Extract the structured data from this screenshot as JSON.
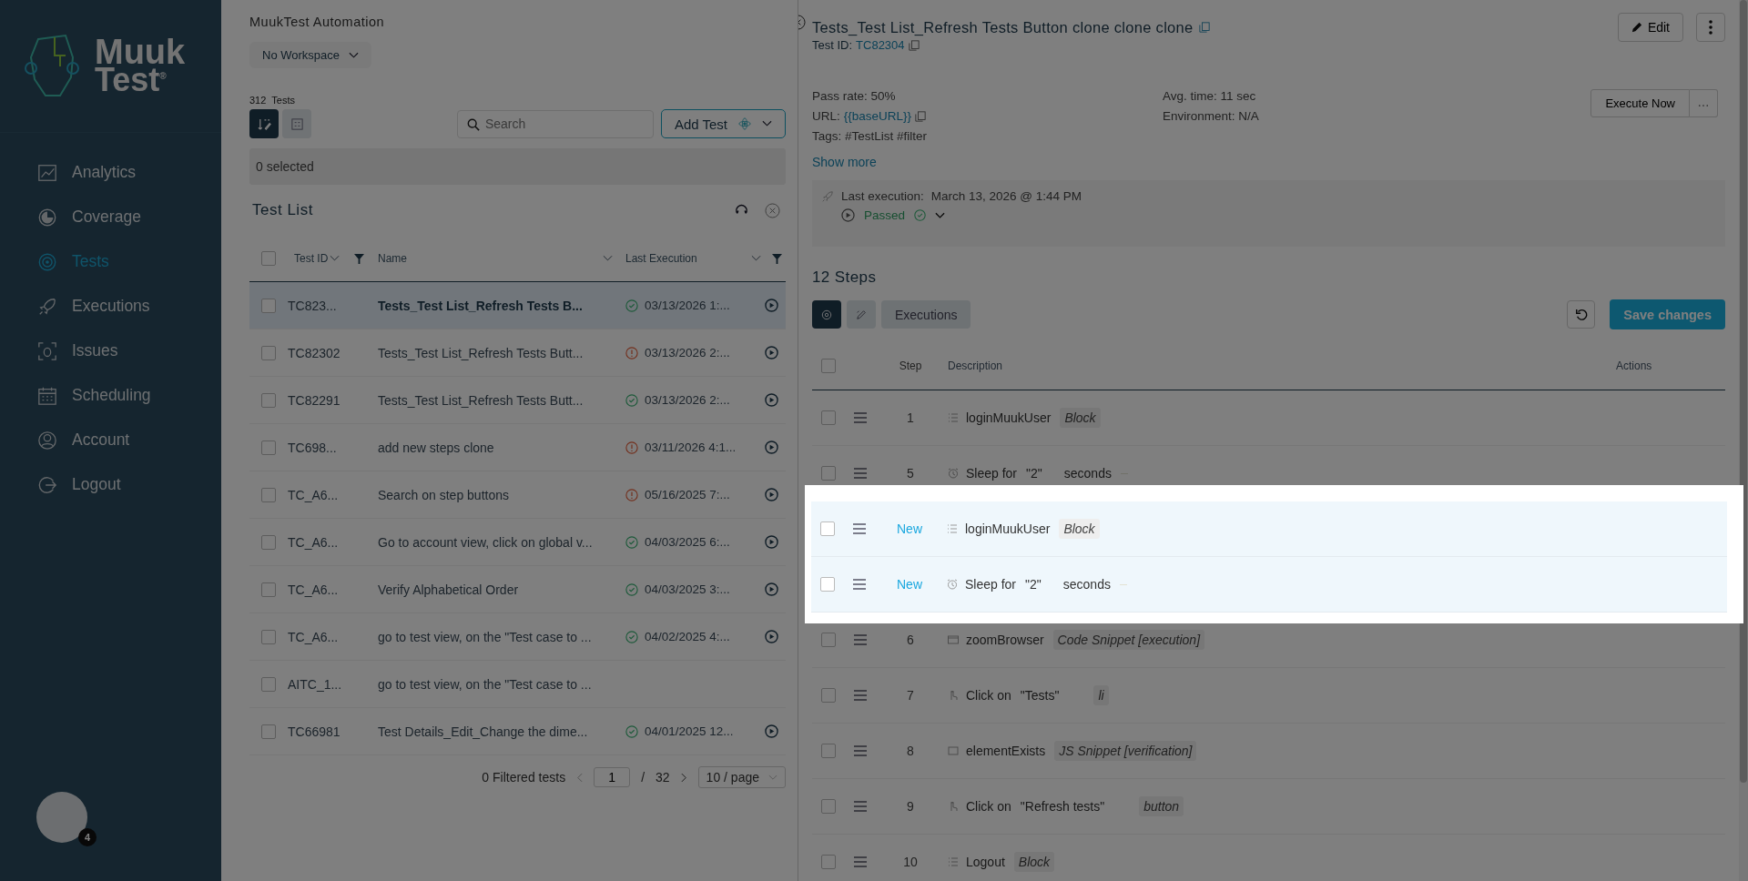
{
  "sidebar": {
    "brand": {
      "line_1": "Muuk",
      "line_2": "Test",
      "mark": "®"
    },
    "items": [
      {
        "label": "Analytics",
        "selected": false
      },
      {
        "label": "Coverage",
        "selected": false
      },
      {
        "label": "Tests",
        "selected": true
      },
      {
        "label": "Executions",
        "selected": false
      },
      {
        "label": "Issues",
        "selected": false
      },
      {
        "label": "Scheduling",
        "selected": false
      },
      {
        "label": "Account",
        "selected": false
      },
      {
        "label": "Logout",
        "selected": false
      }
    ],
    "avatar_badge": "4"
  },
  "tests": {
    "workspace_title": "MuukTest Automation",
    "workspace_select": "No Workspace",
    "count": "312",
    "count_label": "Tests",
    "view_toggle": [
      {
        "selected": true
      },
      {
        "selected": false
      }
    ],
    "search": {
      "placeholder": "Search"
    },
    "add_button": "Add Test",
    "selection": "0 selected",
    "title": "Test List",
    "columns": [
      "Test ID",
      "Name",
      "Last Execution"
    ],
    "all_checked": false,
    "rows": [
      {
        "id": "TC823...",
        "name": "Tests_Test List_Refresh Tests B...",
        "passed": true,
        "date": "03/13/2026 1:...",
        "selected": true,
        "checked": false
      },
      {
        "id": "TC82302",
        "name": "Tests_Test List_Refresh Tests Butt...",
        "passed": false,
        "date": "03/13/2026 2:...",
        "selected": false,
        "checked": false
      },
      {
        "id": "TC82291",
        "name": "Tests_Test List_Refresh Tests Butt...",
        "passed": true,
        "date": "03/13/2026 2:...",
        "selected": false,
        "checked": false
      },
      {
        "id": "TC698...",
        "name": "add new steps clone",
        "passed": false,
        "date": "03/11/2026 4:1...",
        "selected": false,
        "checked": false
      },
      {
        "id": "TC_A6...",
        "name": "Search on step buttons",
        "passed": false,
        "date": "05/16/2025 7:...",
        "selected": false,
        "checked": false
      },
      {
        "id": "TC_A6...",
        "name": "Go to account view, click on global v...",
        "passed": true,
        "date": "04/03/2025 6:...",
        "selected": false,
        "checked": false
      },
      {
        "id": "TC_A6...",
        "name": "Verify Alphabetical Order",
        "passed": true,
        "date": "04/03/2025 3:...",
        "selected": false,
        "checked": false
      },
      {
        "id": "TC_A6...",
        "name": "go to test view, on the \"Test case to ...",
        "passed": true,
        "date": "04/02/2025 4:...",
        "selected": false,
        "checked": false
      },
      {
        "id": "AITC_1...",
        "name": "go to test view, on the \"Test case to ...",
        "selected": false,
        "checked": false
      },
      {
        "id": "TC66981",
        "name": "Test Details_Edit_Change the dime...",
        "passed": true,
        "date": "04/01/2025 12...",
        "selected": false,
        "checked": false
      }
    ],
    "pagination": {
      "summary": "0 Filtered tests",
      "page": "1",
      "separator": "/",
      "total": "32",
      "page_size": "10 / page"
    }
  },
  "detail": {
    "title": "Tests_Test List_Refresh Tests Button clone clone clone",
    "test_id_label": "Test ID:",
    "test_id": "TC82304",
    "edit_button": "Edit",
    "execute_button": "Execute Now",
    "pass_rate": "Pass rate: 50%",
    "url_label": "URL:",
    "url": "{{baseURL}}",
    "tags": "Tags: #TestList #filter",
    "avg_time": "Avg. time: 11 sec",
    "environment": "Environment: N/A",
    "show_more": "Show more",
    "last_execution": {
      "label": "Last execution:",
      "date": "March 13, 2026 @ 1:44 PM",
      "status": "Passed"
    },
    "steps_title": "12 Steps",
    "step_tabs": [
      {
        "kind": "icon",
        "selected": true
      },
      {
        "kind": "icon",
        "selected": false
      },
      {
        "kind": "text",
        "label": "Executions",
        "selected": false
      }
    ],
    "save_button": "Save changes",
    "columns": [
      "Step",
      "Description",
      "Actions"
    ],
    "all_checked": false,
    "steps": [
      {
        "step": "1",
        "kind": "block",
        "name": "loginMuukUser",
        "tag": "Block",
        "new": false,
        "checked": false
      },
      {
        "step": "5",
        "kind": "sleep",
        "action": "Sleep for",
        "target": "\"2\"",
        "unit": "seconds",
        "new": false,
        "checked": false
      },
      {
        "step": "New",
        "kind": "block",
        "name": "loginMuukUser",
        "tag": "Block",
        "new": true,
        "checked": false
      },
      {
        "step": "New",
        "kind": "sleep",
        "action": "Sleep for",
        "target": "\"2\"",
        "unit": "seconds",
        "new": true,
        "checked": false
      },
      {
        "step": "6",
        "kind": "snippet",
        "name": "zoomBrowser",
        "tag": "Code Snippet [execution]",
        "new": false,
        "checked": false
      },
      {
        "step": "7",
        "kind": "click",
        "action": "Click on",
        "target": "\"Tests\"",
        "tag": "li",
        "new": false,
        "checked": false
      },
      {
        "step": "8",
        "kind": "check",
        "name": "elementExists",
        "tag": "JS Snippet [verification]",
        "new": false,
        "checked": false
      },
      {
        "step": "9",
        "kind": "click",
        "action": "Click on",
        "target": "\"Refresh tests\"",
        "tag": "button",
        "new": false,
        "checked": false
      },
      {
        "step": "10",
        "kind": "block",
        "name": "Logout",
        "tag": "Block",
        "new": false,
        "checked": false
      }
    ]
  }
}
